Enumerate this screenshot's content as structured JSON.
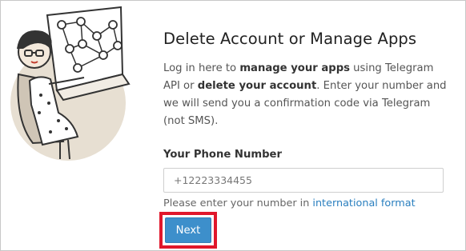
{
  "page": {
    "title": "Delete Account or Manage Apps",
    "description": {
      "part1": "Log in here to ",
      "bold1": "manage your apps",
      "part2": " using Telegram API or ",
      "bold2": "delete your account",
      "part3": ". Enter your number and we will send you a confirmation code via Telegram (not SMS)."
    }
  },
  "phone": {
    "label": "Your Phone Number",
    "placeholder": "+12223334455",
    "hint_prefix": "Please enter your number in ",
    "hint_link": "international format"
  },
  "actions": {
    "next_label": "Next"
  },
  "illustration": {
    "icon": "telegram-mascot-illustration"
  },
  "colors": {
    "accent": "#3d8fcb",
    "link": "#2a7fbf",
    "highlight": "#e0172b"
  }
}
